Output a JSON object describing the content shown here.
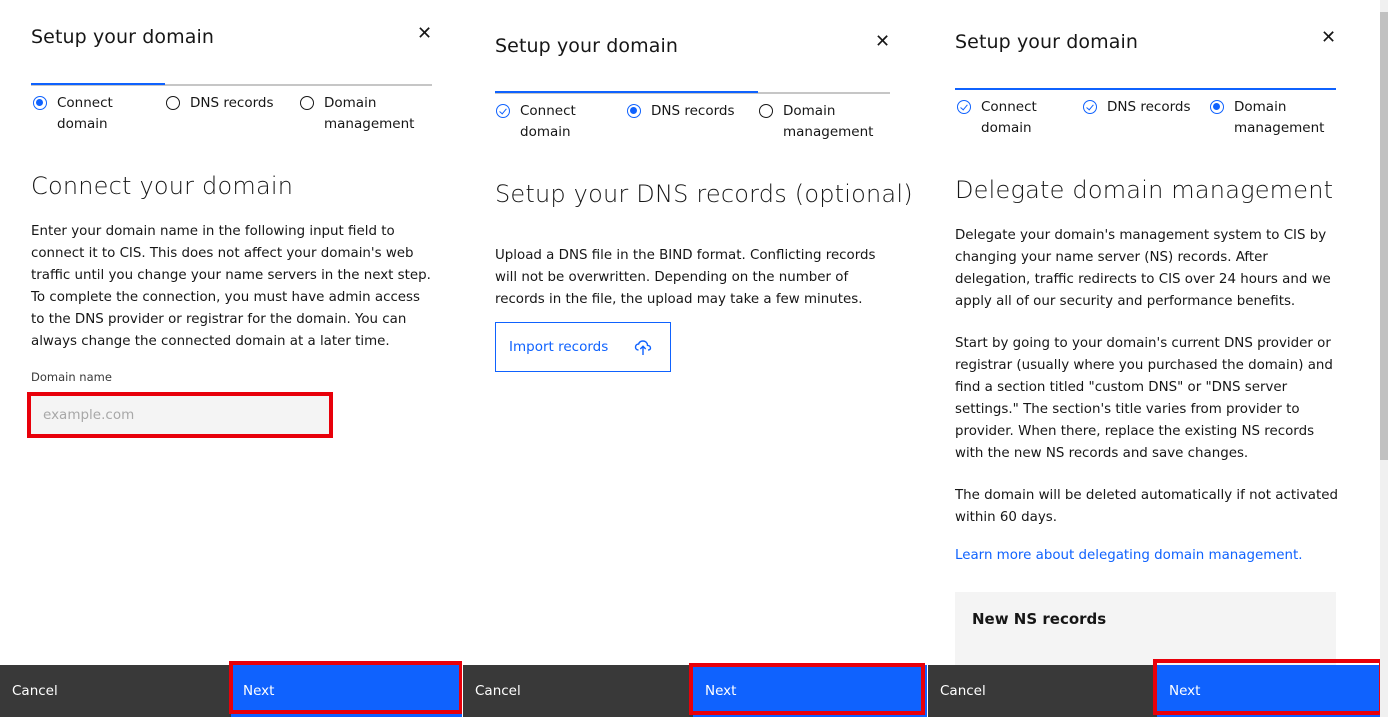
{
  "panels": [
    {
      "title": "Setup your domain",
      "close_glyph": "✕",
      "steps": [
        {
          "line1": "Connect",
          "line2": "domain",
          "state": "current"
        },
        {
          "line1": "DNS records",
          "line2": "",
          "state": "incomplete"
        },
        {
          "line1": "Domain",
          "line2": "management",
          "state": "incomplete"
        }
      ],
      "heading": "Connect your domain",
      "body": "Enter your domain name in the following input field to connect it to CIS. This does not affect your domain's web traffic until you change your name servers in the next step. To complete the connection, you must have admin access to the DNS provider or registrar for the domain. You can always change the connected domain at a later time.",
      "field_label": "Domain name",
      "field_placeholder": "example.com",
      "field_value": "",
      "cancel_label": "Cancel",
      "next_label": "Next"
    },
    {
      "title": "Setup your domain",
      "close_glyph": "✕",
      "steps": [
        {
          "line1": "Connect",
          "line2": "domain",
          "state": "complete"
        },
        {
          "line1": "DNS records",
          "line2": "",
          "state": "current"
        },
        {
          "line1": "Domain",
          "line2": "management",
          "state": "incomplete"
        }
      ],
      "heading": "Setup your DNS records (optional)",
      "body": "Upload a DNS file in the BIND format. Conflicting records will not be overwritten. Depending on the number of records in the file, the upload may take a few minutes.",
      "import_label": "Import records",
      "import_icon": "cloud-upload-icon",
      "cancel_label": "Cancel",
      "next_label": "Next"
    },
    {
      "title": "Setup your domain",
      "close_glyph": "✕",
      "steps": [
        {
          "line1": "Connect",
          "line2": "domain",
          "state": "complete"
        },
        {
          "line1": "DNS records",
          "line2": "",
          "state": "complete"
        },
        {
          "line1": "Domain",
          "line2": "management",
          "state": "current"
        }
      ],
      "heading": "Delegate domain management",
      "body1": "Delegate your domain's management system to CIS by changing your name server (NS) records. After delegation, traffic redirects to CIS over 24 hours and we apply all of our security and performance benefits.",
      "body2": "Start by going to your domain's current DNS provider or registrar (usually where you purchased the domain) and find a section titled \"custom DNS\" or \"DNS server settings.\" The section's title varies from provider to provider. When there, replace the existing NS records with the new NS records and save changes.",
      "body3": "The domain will be deleted automatically if not activated within 60 days.",
      "link": "Learn more about delegating domain management.",
      "ns_title": "New NS records",
      "cancel_label": "Cancel",
      "next_label": "Next"
    }
  ],
  "colors": {
    "accent": "#0f62fe",
    "highlight": "#e8000a",
    "cancel_bg": "#393939",
    "text": "#161616"
  }
}
